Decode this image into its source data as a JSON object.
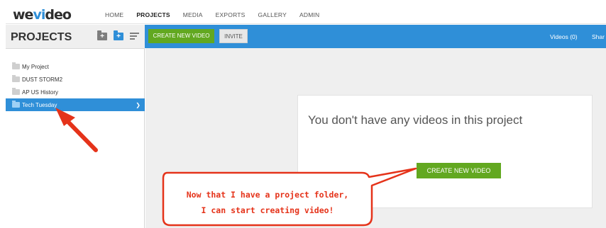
{
  "brand": {
    "logo_prefix": "we",
    "logo_accent": "vi",
    "logo_suffix": "deo"
  },
  "nav": {
    "items": [
      "HOME",
      "PROJECTS",
      "MEDIA",
      "EXPORTS",
      "GALLERY",
      "ADMIN"
    ],
    "active": "PROJECTS"
  },
  "sidebar": {
    "title": "PROJECTS",
    "projects": [
      {
        "label": "My Project"
      },
      {
        "label": "DUST STORM2"
      },
      {
        "label": "AP US History"
      },
      {
        "label": "Tech Tuesday"
      }
    ],
    "selected": "Tech Tuesday"
  },
  "toolbar": {
    "create_label": "CREATE NEW VIDEO",
    "invite_label": "INVITE",
    "videos_label": "Videos (0)",
    "share_label": "Shar"
  },
  "empty_state": {
    "message": "You don't have any videos in this project",
    "create_label": "CREATE NEW VIDEO"
  },
  "annotation": {
    "line1": "Now that I have a project folder,",
    "line2": "I can start creating video!"
  },
  "colors": {
    "accent_blue": "#2f8fd8",
    "green": "#62a820",
    "annotation_red": "#e5331a"
  }
}
